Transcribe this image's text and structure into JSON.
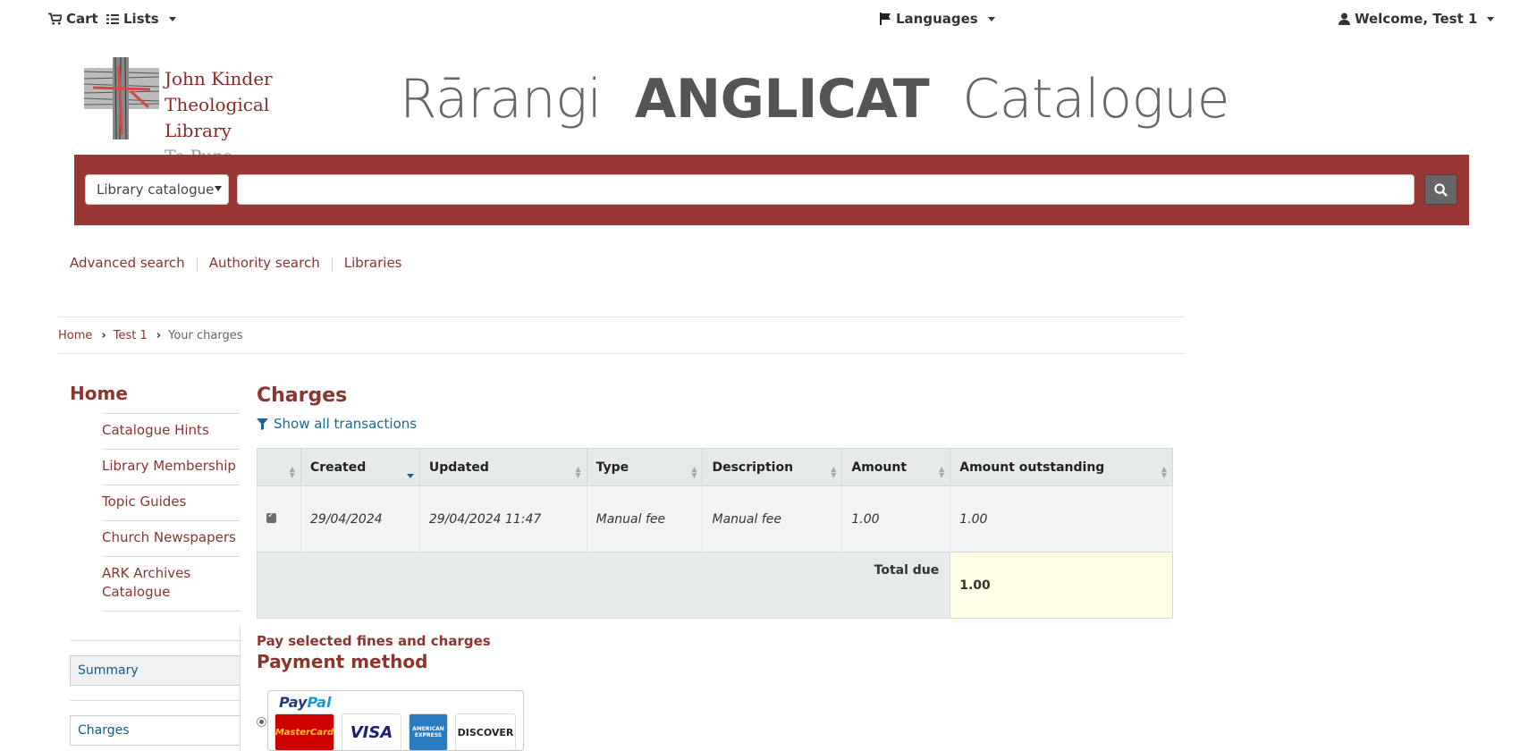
{
  "topbar": {
    "cart": "Cart",
    "lists": "Lists",
    "languages": "Languages",
    "welcome": "Welcome, Test 1"
  },
  "logo": {
    "line1": "John Kinder",
    "line2": "Theological Library",
    "line3": "Te Puna Atuatanga"
  },
  "masthead": {
    "part1": "Rārangi",
    "part2": "ANGLICAT",
    "part3": "Catalogue"
  },
  "search": {
    "scope": "Library catalogue",
    "query": ""
  },
  "moresearches": [
    "Advanced search",
    "Authority search",
    "Libraries"
  ],
  "breadcrumb": {
    "home": "Home",
    "user": "Test 1",
    "current": "Your charges"
  },
  "sidenav": {
    "home": "Home",
    "items": [
      "Catalogue Hints",
      "Library Membership",
      "Topic Guides",
      "Church Newspapers",
      "ARK Archives Catalogue"
    ]
  },
  "usermenu": {
    "summary": "Summary",
    "charges": "Charges"
  },
  "main": {
    "title": "Charges",
    "filter": "Show all transactions",
    "columns": [
      "",
      "Created",
      "Updated",
      "Type",
      "Description",
      "Amount",
      "Amount outstanding"
    ],
    "rows": [
      {
        "created": "29/04/2024",
        "updated": "29/04/2024 11:47",
        "type": "Manual fee",
        "description": "Manual fee",
        "amount": "1.00",
        "outstanding": "1.00"
      }
    ],
    "total_label": "Total due",
    "total_value": "1.00",
    "pay_selected": "Pay selected fines and charges",
    "payment_method": "Payment method"
  },
  "payment": {
    "brand_a": "Pay",
    "brand_b": "Pal",
    "cards": [
      "MasterCard",
      "VISA",
      "AMERICAN EXPRESS",
      "DISCOVER"
    ]
  },
  "colors": {
    "brand": "#983734",
    "link": "#8a3530",
    "accent_link": "#1a6890",
    "total_bg": "#ffffe5"
  }
}
